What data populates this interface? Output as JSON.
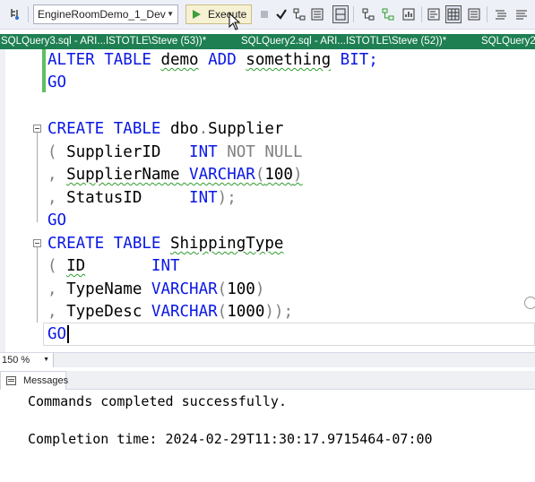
{
  "toolbar": {
    "database": "EngineRoomDemo_1_Dev",
    "execute_label": "Execute",
    "icons": [
      "object-explorer-icon",
      "stop-icon",
      "parse-checkmark-icon",
      "display-plan-icon",
      "query-options-icon",
      "results-grid-icon",
      "include-plan-icon",
      "client-stats-icon",
      "results-text-icon",
      "results-grid-icon",
      "results-file-icon",
      "comment-icon",
      "uncomment-icon"
    ]
  },
  "tabs": [
    {
      "label": "SQLQuery3.sql - ARI...ISTOTLE\\Steve (53))*"
    },
    {
      "label": "SQLQuery2.sql - ARI...ISTOTLE\\Steve (52))*"
    },
    {
      "label": "SQLQuery2"
    }
  ],
  "editor": {
    "lines": [
      {
        "t1": "ALTER TABLE ",
        "t2": "demo",
        "t3": " ADD ",
        "t4": "something",
        "t5": " BIT;"
      },
      {
        "t1": "GO"
      },
      {
        "t1": ""
      },
      {
        "t1": "CREATE TABLE ",
        "t2": "dbo",
        "t3": ".",
        "t4": "Supplier"
      },
      {
        "t1": "( ",
        "t2": "SupplierID",
        "t3": "   INT ",
        "t4": "NOT NULL"
      },
      {
        "t1": ", ",
        "t2": "SupplierName",
        "t3": " VARCHAR",
        "t4": "(",
        "t5": "100",
        "t6": ")"
      },
      {
        "t1": ", ",
        "t2": "StatusID",
        "t3": "     INT",
        "t4": ");"
      },
      {
        "t1": "GO"
      },
      {
        "t1": "CREATE TABLE ",
        "t2": "ShippingType"
      },
      {
        "t1": "( ",
        "t2": "ID",
        "t3": "       INT"
      },
      {
        "t1": ", ",
        "t2": "TypeName",
        "t3": " VARCHAR",
        "t4": "(",
        "t5": "100",
        "t6": ")"
      },
      {
        "t1": ", ",
        "t2": "TypeDesc",
        "t3": " VARCHAR",
        "t4": "(",
        "t5": "1000",
        "t6": "));"
      },
      {
        "t1": "GO"
      }
    ]
  },
  "zoom": "150 %",
  "messages": {
    "tab_label": "Messages",
    "line1": "Commands completed successfully.",
    "line2": "Completion time: 2024-02-29T11:30:17.9715464-07:00"
  },
  "colors": {
    "keyword": "#0a17e6",
    "gray": "#808080",
    "tabbar": "#1e7f52",
    "squiggle": "#2e9e2e"
  }
}
